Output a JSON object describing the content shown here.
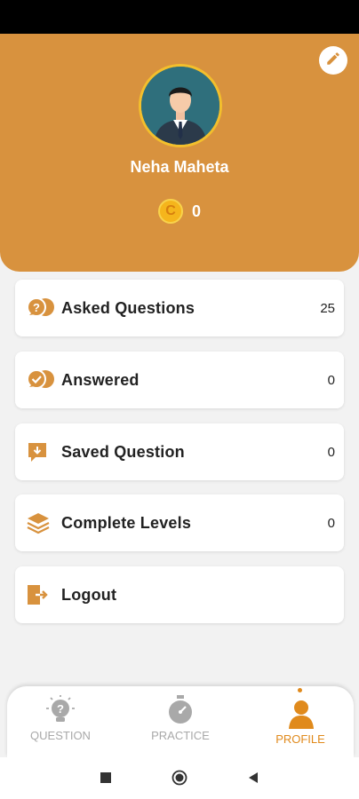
{
  "colors": {
    "accent": "#d8923e",
    "active": "#e08a1c",
    "inactive": "#a9a9a9"
  },
  "profile": {
    "name": "Neha Maheta",
    "coins": "0",
    "edit_icon": "pencil-icon",
    "coin_icon": "coin-icon",
    "coin_glyph": "C"
  },
  "menu": [
    {
      "label": "Asked Questions",
      "count": "25",
      "icon": "chat-question-icon"
    },
    {
      "label": "Answered",
      "count": "0",
      "icon": "chat-check-icon"
    },
    {
      "label": "Saved Question",
      "count": "0",
      "icon": "save-download-icon"
    },
    {
      "label": "Complete Levels",
      "count": "0",
      "icon": "layers-icon"
    },
    {
      "label": "Logout",
      "count": "",
      "icon": "logout-icon"
    }
  ],
  "nav": [
    {
      "label": "QUESTION",
      "icon": "bulb-question-icon"
    },
    {
      "label": "PRACTICE",
      "icon": "stopwatch-icon"
    },
    {
      "label": "PROFILE",
      "icon": "person-icon",
      "active": true
    }
  ]
}
